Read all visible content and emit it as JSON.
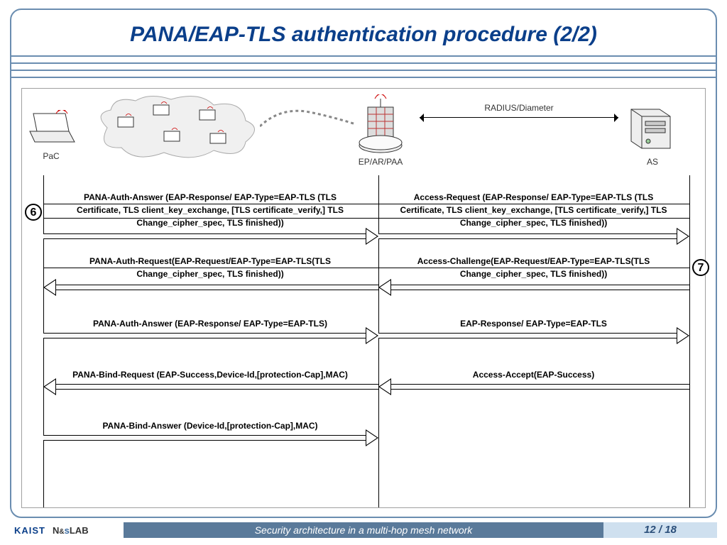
{
  "slide": {
    "title": "PANA/EAP-TLS authentication procedure (2/2)",
    "footer_subtitle": "Security architecture in a multi-hop mesh network",
    "page": "12 / 18",
    "logo_kaist": "KAIST",
    "logo_lab": "N&sLAB"
  },
  "topology": {
    "node_pac": "PaC",
    "node_ep": "EP/AR/PAA",
    "node_as": "AS",
    "link_label": "RADIUS/Diameter"
  },
  "steps": {
    "step6": "6",
    "step7": "7"
  },
  "messages": {
    "m1_left_l1": "PANA-Auth-Answer (EAP-Response/ EAP-Type=EAP-TLS (TLS",
    "m1_left_l2": "Certificate, TLS client_key_exchange, [TLS certificate_verify,] TLS",
    "m1_left_l3": "Change_cipher_spec, TLS finished))",
    "m1_right_l1": "Access-Request (EAP-Response/ EAP-Type=EAP-TLS (TLS",
    "m1_right_l2": "Certificate, TLS client_key_exchange, [TLS certificate_verify,] TLS",
    "m1_right_l3": "Change_cipher_spec, TLS finished))",
    "m2_left_l1": "PANA-Auth-Request(EAP-Request/EAP-Type=EAP-TLS(TLS",
    "m2_left_l2": "Change_cipher_spec, TLS finished))",
    "m2_right_l1": "Access-Challenge(EAP-Request/EAP-Type=EAP-TLS(TLS",
    "m2_right_l2": "Change_cipher_spec, TLS finished))",
    "m3_left": "PANA-Auth-Answer (EAP-Response/ EAP-Type=EAP-TLS)",
    "m3_right": "EAP-Response/ EAP-Type=EAP-TLS",
    "m4_left": "PANA-Bind-Request (EAP-Success,Device-Id,[protection-Cap],MAC)",
    "m4_right": "Access-Accept(EAP-Success)",
    "m5_left": "PANA-Bind-Answer (Device-Id,[protection-Cap],MAC)"
  }
}
